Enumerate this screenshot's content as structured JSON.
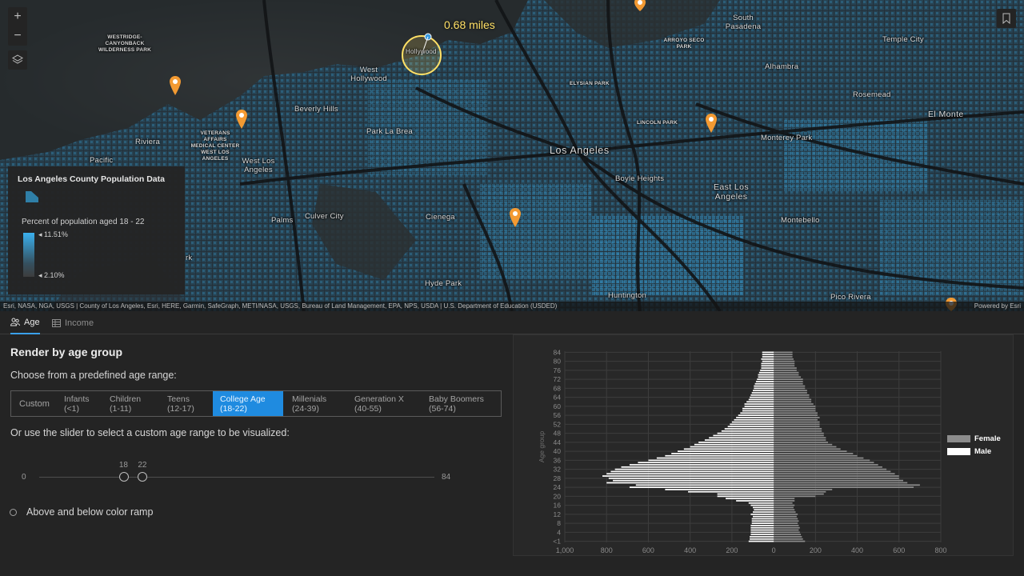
{
  "map": {
    "measure_label": "0.68 miles",
    "labels": [
      {
        "text": "WESTRIDGE-CANYONBACK WILDERNESS PARK",
        "kind": "small"
      },
      {
        "text": "VETERANS AFFAIRS MEDICAL CENTER WEST LOS ANGELES",
        "kind": "small"
      },
      {
        "text": "ARROYO SECO PARK",
        "kind": "small"
      },
      {
        "text": "ELYSIAN PARK",
        "kind": "small"
      },
      {
        "text": "LINCOLN PARK",
        "kind": "small"
      },
      {
        "text": "South Pasadena",
        "kind": "normal"
      },
      {
        "text": "Temple City",
        "kind": "normal"
      },
      {
        "text": "Alhambra",
        "kind": "normal"
      },
      {
        "text": "Rosemead",
        "kind": "normal"
      },
      {
        "text": "El Monte",
        "kind": "mid"
      },
      {
        "text": "Monterey Park",
        "kind": "normal"
      },
      {
        "text": "West Hollywood",
        "kind": "normal"
      },
      {
        "text": "Hollywood",
        "kind": "normal"
      },
      {
        "text": "Beverly Hills",
        "kind": "normal"
      },
      {
        "text": "Park La Brea",
        "kind": "normal"
      },
      {
        "text": "Los Angeles",
        "kind": "big"
      },
      {
        "text": "Boyle Heights",
        "kind": "normal"
      },
      {
        "text": "East Los Angeles",
        "kind": "mid"
      },
      {
        "text": "Riviera",
        "kind": "normal"
      },
      {
        "text": "Pacific",
        "kind": "normal"
      },
      {
        "text": "West Los Angeles",
        "kind": "normal"
      },
      {
        "text": "Palms",
        "kind": "normal"
      },
      {
        "text": "Culver City",
        "kind": "normal"
      },
      {
        "text": "Cienega",
        "kind": "normal"
      },
      {
        "text": "Montebello",
        "kind": "normal"
      },
      {
        "text": "Hyde Park",
        "kind": "normal"
      },
      {
        "text": "Huntington",
        "kind": "normal"
      },
      {
        "text": "Pico Rivera",
        "kind": "normal"
      },
      {
        "text": "rk",
        "kind": "normal"
      }
    ],
    "legend": {
      "title": "Los Angeles County Population Data",
      "subtitle": "Percent of population aged 18 - 22",
      "max_label": "11.51%",
      "min_label": "2.10%"
    },
    "attribution": "Esri, NASA, NGA, USGS | County of Los Angeles, Esri, HERE, Garmin, SafeGraph, METI/NASA, USGS, Bureau of Land Management, EPA, NPS, USDA | U.S. Department of Education (USDED)",
    "powered_by": "Powered by Esri",
    "colors": {
      "population": "#3ab0ee",
      "pin": "#f39a32",
      "measure": "#ffe066"
    }
  },
  "tabs": [
    {
      "label": "Age",
      "icon": "people-icon",
      "active": true
    },
    {
      "label": "Income",
      "icon": "table-icon",
      "active": false
    }
  ],
  "panel": {
    "title": "Render by age group",
    "choose_text": "Choose from a predefined age range:",
    "age_ranges": [
      {
        "label": "Custom",
        "range": ""
      },
      {
        "label": "Infants",
        "range": "(<1)"
      },
      {
        "label": "Children",
        "range": "(1-11)"
      },
      {
        "label": "Teens",
        "range": "(12-17)"
      },
      {
        "label": "College Age",
        "range": "(18-22)",
        "selected": true
      },
      {
        "label": "Millenials",
        "range": "(24-39)"
      },
      {
        "label": "Generation X",
        "range": "(40-55)"
      },
      {
        "label": "Baby Boomers",
        "range": "(56-74)"
      }
    ],
    "slider_text": "Or use the slider to select a custom age range to be visualized:",
    "slider": {
      "min": "0",
      "max": "84",
      "low": "18",
      "high": "22",
      "min_value": 0,
      "max_value": 84,
      "low_value": 18,
      "high_value": 22
    },
    "radio_label": "Above and below color ramp"
  },
  "chart_data": {
    "type": "bar",
    "orientation": "horizontal",
    "ylabel": "Age group",
    "y_ticks": [
      "<1",
      "4",
      "8",
      "12",
      "16",
      "20",
      "24",
      "28",
      "32",
      "36",
      "40",
      "44",
      "48",
      "52",
      "56",
      "60",
      "64",
      "68",
      "72",
      "76",
      "80",
      "84"
    ],
    "x_ticks": [
      "1,000",
      "800",
      "600",
      "400",
      "200",
      "0",
      "200",
      "400",
      "600",
      "800"
    ],
    "xlim": [
      -1000,
      800
    ],
    "ages": [
      0,
      1,
      2,
      3,
      4,
      5,
      6,
      7,
      8,
      9,
      10,
      11,
      12,
      13,
      14,
      15,
      16,
      17,
      18,
      19,
      20,
      21,
      22,
      23,
      24,
      25,
      26,
      27,
      28,
      29,
      30,
      31,
      32,
      33,
      34,
      35,
      36,
      37,
      38,
      39,
      40,
      41,
      42,
      43,
      44,
      45,
      46,
      47,
      48,
      49,
      50,
      51,
      52,
      53,
      54,
      55,
      56,
      57,
      58,
      59,
      60,
      61,
      62,
      63,
      64,
      65,
      66,
      67,
      68,
      69,
      70,
      71,
      72,
      73,
      74,
      75,
      76,
      77,
      78,
      79,
      80,
      81,
      82,
      83,
      84
    ],
    "series": [
      {
        "name": "Female",
        "color": "#8c8c8c",
        "values": [
          150,
          140,
          135,
          130,
          125,
          120,
          125,
          120,
          115,
          120,
          115,
          110,
          115,
          105,
          100,
          95,
          100,
          90,
          100,
          100,
          200,
          240,
          250,
          280,
          670,
          700,
          640,
          620,
          600,
          600,
          580,
          560,
          540,
          520,
          500,
          480,
          460,
          430,
          400,
          380,
          350,
          320,
          300,
          280,
          260,
          250,
          250,
          240,
          240,
          230,
          230,
          220,
          220,
          220,
          210,
          220,
          210,
          210,
          200,
          200,
          200,
          190,
          180,
          180,
          170,
          170,
          160,
          160,
          150,
          150,
          140,
          140,
          140,
          130,
          120,
          120,
          110,
          110,
          100,
          100,
          100,
          95,
          90,
          90,
          90
        ]
      },
      {
        "name": "Male",
        "color": "#ffffff",
        "values": [
          -120,
          -115,
          -115,
          -110,
          -110,
          -110,
          -110,
          -110,
          -105,
          -105,
          -105,
          -100,
          -110,
          -100,
          -95,
          -100,
          -110,
          -120,
          -180,
          -230,
          -270,
          -270,
          -410,
          -520,
          -690,
          -660,
          -800,
          -770,
          -790,
          -820,
          -800,
          -780,
          -760,
          -730,
          -690,
          -650,
          -600,
          -560,
          -520,
          -490,
          -460,
          -430,
          -400,
          -380,
          -360,
          -330,
          -310,
          -290,
          -270,
          -250,
          -235,
          -220,
          -210,
          -200,
          -190,
          -180,
          -170,
          -160,
          -150,
          -150,
          -140,
          -140,
          -130,
          -120,
          -115,
          -110,
          -105,
          -100,
          -95,
          -95,
          -90,
          -85,
          -80,
          -75,
          -75,
          -70,
          -65,
          -60,
          -60,
          -60,
          -55,
          -60,
          -55,
          -55,
          -55
        ]
      }
    ]
  }
}
